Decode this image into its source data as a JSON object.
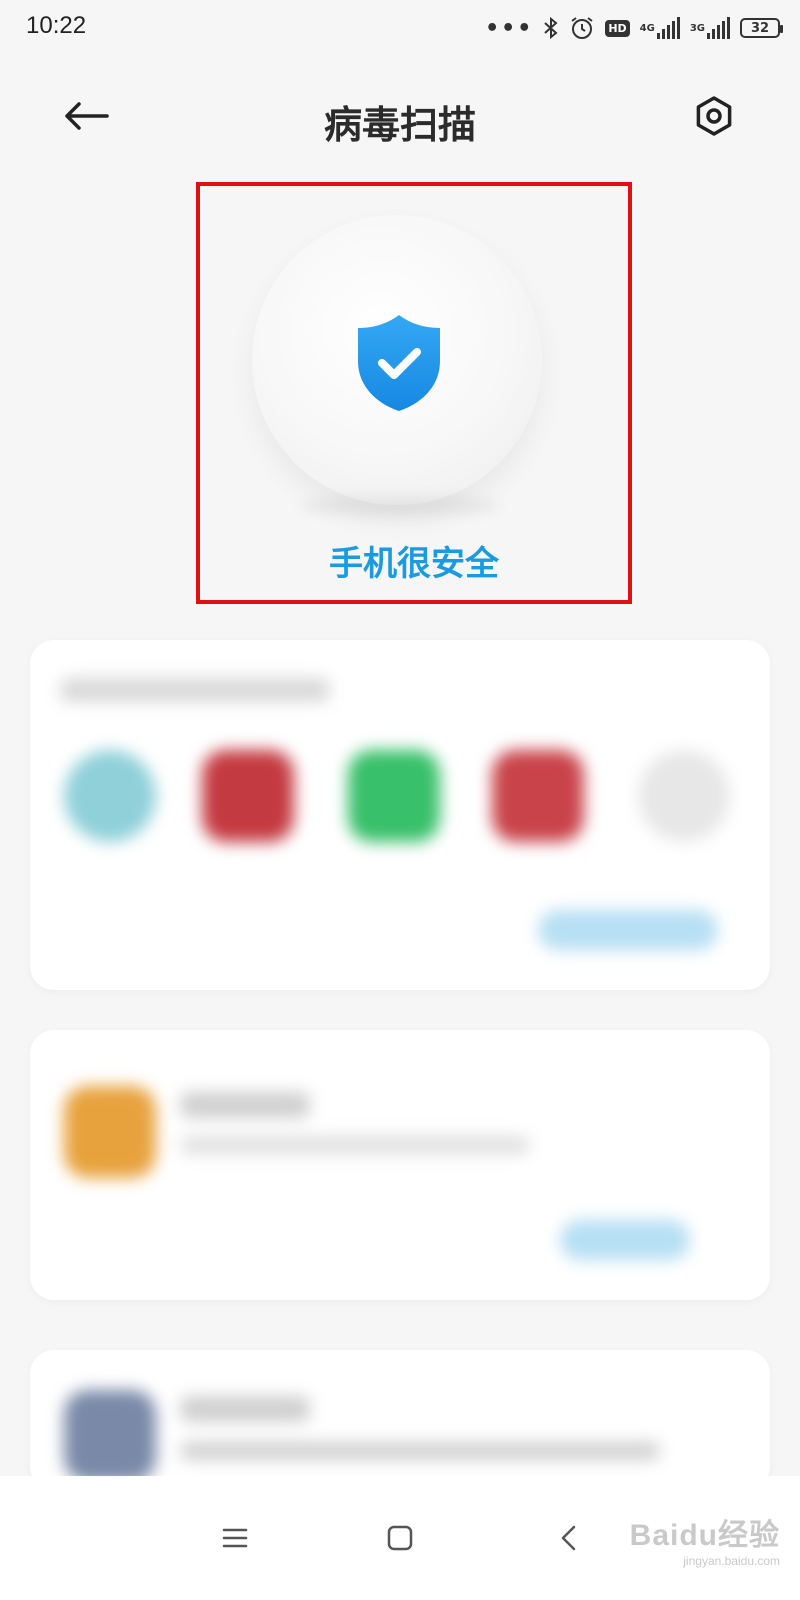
{
  "status_bar": {
    "time": "10:22",
    "dots": "•••",
    "hd": "HD",
    "network1": "4G",
    "network2": "3G",
    "battery": "32"
  },
  "header": {
    "title": "病毒扫描",
    "back_icon": "arrow-left-icon",
    "settings_icon": "settings-icon"
  },
  "hero": {
    "status_text": "手机很安全",
    "icon": "shield-check-icon",
    "highlight_color": "#e00f12",
    "accent_color": "#1a9be0"
  },
  "watermark": {
    "main": "Baidu经验",
    "sub": "jingyan.baidu.com"
  },
  "bottom_nav": {
    "menu_icon": "menu-icon",
    "home_icon": "home-icon",
    "back_icon": "back-chevron-icon"
  }
}
